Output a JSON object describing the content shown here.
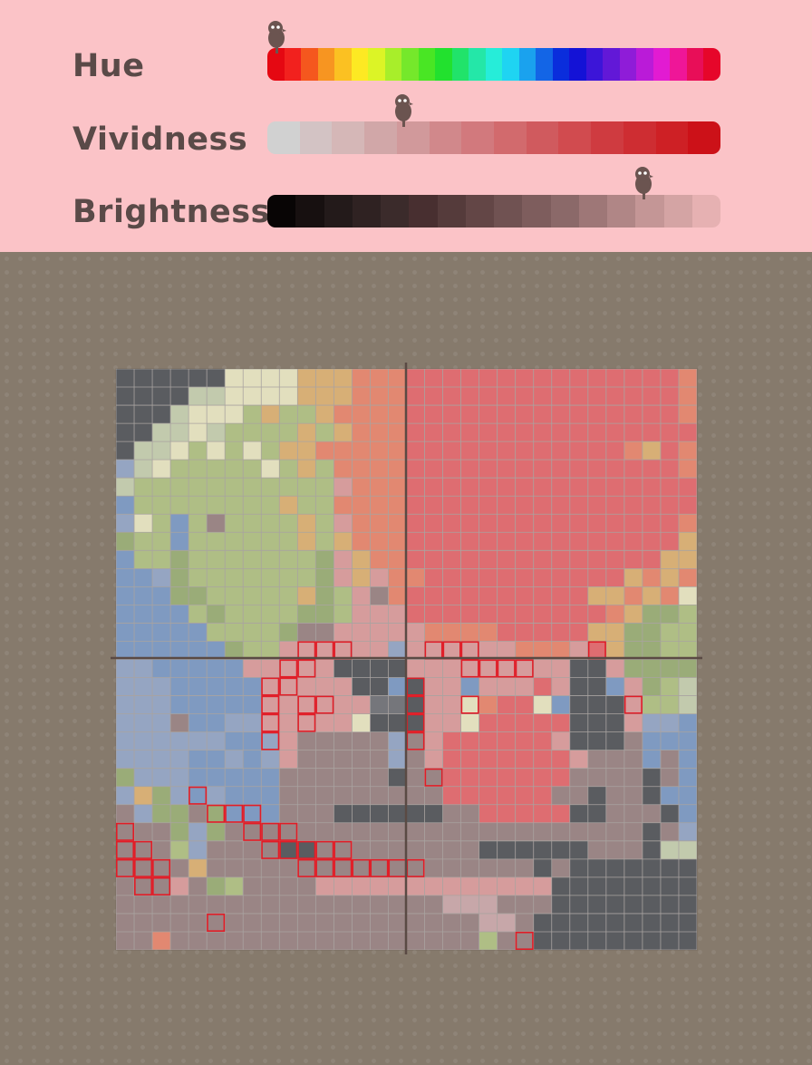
{
  "sliders": {
    "hue": {
      "label": "Hue",
      "level": 0.02
    },
    "vividness": {
      "label": "Vividness",
      "level": 0.3
    },
    "brightness": {
      "label": "Brightness",
      "level": 0.83
    }
  },
  "colors": {
    "panel_bg": "#fbc3c7",
    "canvas_bg": "#867a6c",
    "label_text": "#5a4a48",
    "knob": "#6b5450",
    "axis_line": "#5a4a44",
    "grid_line": "#a9a3a0",
    "selection_outline": "#e21c26",
    "hue_scale": [
      "#e50812",
      "#f2211e",
      "#f5571e",
      "#f79521",
      "#fbc122",
      "#fde923",
      "#dcf426",
      "#a8ee2a",
      "#75e82b",
      "#49e624",
      "#22e12e",
      "#21e36a",
      "#24e7a8",
      "#26edd9",
      "#1fd4f2",
      "#1aa2ee",
      "#1365e6",
      "#0a2ddc",
      "#1412d6",
      "#3c15d8",
      "#6218d7",
      "#8f1cd8",
      "#ba1bd8",
      "#e21bd2",
      "#ef1698",
      "#e80e58",
      "#e6062a"
    ],
    "vividness_scale": [
      "#d1d1d1",
      "#d3c3c4",
      "#d5b7b7",
      "#d1a7a8",
      "#d1999b",
      "#d1888b",
      "#d2797d",
      "#d26a6d",
      "#d05a5e",
      "#d14b4f",
      "#cf3b40",
      "#ce2d32",
      "#ce2025",
      "#cc1118"
    ],
    "brightness_scale": [
      "#080505",
      "#171010",
      "#231a1a",
      "#2f2222",
      "#3b2b2b",
      "#482f30",
      "#553b3b",
      "#634646",
      "#705252",
      "#7e5d5d",
      "#8b6969",
      "#9e7777",
      "#b08686",
      "#c49696",
      "#d4a4a4",
      "#e6b1b2"
    ],
    "palette": {
      "D": "#5a5c60",
      "E": "#75767b",
      "C": "#c2caad",
      "W": "#e2dfbe",
      "L": "#afbe85",
      "G": "#9aac78",
      "Y": "#d7af76",
      "O": "#e28871",
      "R": "#de6d71",
      "P": "#d69c9c",
      "S": "#c7a7a9",
      "M": "#9a8585",
      "B": "#7f9ac1",
      "b": "#95a5c2",
      "A": "#88898d"
    }
  },
  "icons": {
    "knob": "penguin-knob-icon"
  },
  "board": {
    "columns": 32,
    "rows": 32,
    "grid": [
      "DDDDDDWWWWYYYOOORRRRRRRRRRRRRRRO",
      "DDDDCCWWWWYYYOOORRRRRRRRRRRRRRRO",
      "DDDCWWWLYLLYOOOORRRRRRRRRRRRRRRO",
      "DDCCWCLLLLYLYOOORRRRRRRRRRRRRRRR",
      "DCCWLWLWLYYOOOOORRRRRRRRRRRROYRO",
      "bCWLLLLLWLYLOOOORRRRRRRRRRRRRRRO",
      "CLLLLLLLLLLLPOOORRRRRRRRRRRRRRRR",
      "BLLLLLLLLYLLOOOORRRRRRRRRRRRRRRR",
      "bWLBLMLLLLYLPOOORRRRRRRRRRRRRRRO",
      "GLLBLLLLLLYLYOOORRRRRRRRRRRRRRRY",
      "BLLGLLLLLLLGPYOORRRRRRRRRRRRRRYY",
      "BBbGLLLLLLLGPYPOORRRRRRRRRRRYOYO",
      "BBBGGLLLLLYGLPMORRRRRRRRRRYYOYOW",
      "BBBBLGLLLLGGLPPPRRRRRRRRRRROYGGL",
      "BBBBBLLLLGMMPPPPPOOOORRRRRYYGGLL",
      "BBBBBBGLLPPPPPPbPPPPPPOOOPRYGGLL",
      "bbBBBBBPPPPPDDDDPPPPPPPPPDDPGGGG",
      "bbbBBBBBPPPPPDDBDPPBPPPRPDDBPGLC",
      "bbbBBBBBPPPPPPEEDPPWORRWBDDDPLLC",
      "bbbMBBbbPPPPPWDDDPPWRRRRRDDDPbbB",
      "bbbbbbBBbPMMMMMbMPRRRRRRPDDDMBBB",
      "bbbbBBbBbPMMMMMbMPRRRRRRRPMMMBMB",
      "GbbbBBBBBMMMMMMDMMRRRRRRRMMMMDMB",
      "bYGbBbBBBMMMMMMMMMRRRRRRMMDMMDBB",
      "MbGGMGBBBMMMDDDDDDMMRRRRRDDMMMDB",
      "MMMGbGMMMMMMMMMMMMMMMMMMMMMMMDMb",
      "MMMLbMMMMDDMMMMMMMMMDDDDDDMMMDCC",
      "MMMMYMMMMMMMMMMMMMMMMMMDMDDDDDDD",
      "MMMPMGLMMMMPPPPPPPPPPPPPDDDDDDDD",
      "MMMMMMMMMMMMMMMMMMSSSMMMDDDDDDDD",
      "MMMMMMMMMMMMMMMMMMMMSSMDDDDDDDDD",
      "MMOMMMMMMMMMMMMMMMMMLMMDDDDDDDDD",
      "MMMMMMMMMLMLLLMLPLMMMLMDDDDDDDDD",
      "MMMMMOMMMMMMMMMMMMMMMMMDDDDDDDDD",
      "LMMMMOMMMMPPPSSSPPMMMMMDDDDDDDDD"
    ],
    "selected_cells": [
      [
        15,
        10
      ],
      [
        15,
        11
      ],
      [
        15,
        12
      ],
      [
        15,
        17
      ],
      [
        15,
        18
      ],
      [
        15,
        19
      ],
      [
        15,
        26
      ],
      [
        16,
        9
      ],
      [
        16,
        10
      ],
      [
        16,
        19
      ],
      [
        16,
        20
      ],
      [
        16,
        21
      ],
      [
        16,
        22
      ],
      [
        17,
        8
      ],
      [
        17,
        9
      ],
      [
        17,
        16
      ],
      [
        18,
        8
      ],
      [
        18,
        10
      ],
      [
        18,
        11
      ],
      [
        18,
        16
      ],
      [
        18,
        19
      ],
      [
        18,
        28
      ],
      [
        19,
        8
      ],
      [
        19,
        10
      ],
      [
        19,
        16
      ],
      [
        20,
        8
      ],
      [
        20,
        16
      ],
      [
        22,
        17
      ],
      [
        23,
        4
      ],
      [
        24,
        5
      ],
      [
        24,
        6
      ],
      [
        24,
        7
      ],
      [
        25,
        0
      ],
      [
        25,
        7
      ],
      [
        25,
        8
      ],
      [
        25,
        9
      ],
      [
        26,
        0
      ],
      [
        26,
        1
      ],
      [
        26,
        8
      ],
      [
        26,
        9
      ],
      [
        26,
        10
      ],
      [
        26,
        11
      ],
      [
        26,
        12
      ],
      [
        27,
        0
      ],
      [
        27,
        1
      ],
      [
        27,
        2
      ],
      [
        27,
        10
      ],
      [
        27,
        11
      ],
      [
        27,
        12
      ],
      [
        27,
        13
      ],
      [
        27,
        14
      ],
      [
        27,
        15
      ],
      [
        27,
        16
      ],
      [
        28,
        1
      ],
      [
        28,
        2
      ],
      [
        30,
        5
      ],
      [
        31,
        22
      ]
    ]
  }
}
